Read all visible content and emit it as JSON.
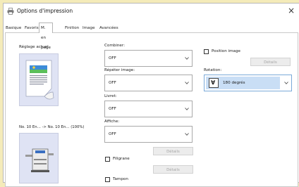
{
  "window": {
    "title": "Options d'impression",
    "close_label": "×"
  },
  "tabs": [
    {
      "label": "Basique",
      "active": false
    },
    {
      "label": "Favoris",
      "active": false
    },
    {
      "label": "M. en page",
      "active": true
    },
    {
      "label": "Finition",
      "active": false
    },
    {
      "label": "Image",
      "active": false
    },
    {
      "label": "Avancées",
      "active": false
    }
  ],
  "left": {
    "current_setting_label": "Réglage actuel",
    "paper_info": "No. 10 En… -> No. 10 En… (100%)"
  },
  "middle": {
    "combine": {
      "label": "Combiner:",
      "value": "OFF"
    },
    "repeat": {
      "label": "Répéter image:",
      "value": "OFF"
    },
    "booklet": {
      "label": "Livret:",
      "value": "OFF"
    },
    "poster": {
      "label": "Affiche:",
      "value": "OFF"
    },
    "details_label": "Détails",
    "watermark_label": "Filigrane",
    "stamp_label": "Tampon"
  },
  "right": {
    "image_position_label": "Position image",
    "details_label": "Détails",
    "rotation": {
      "label": "Rotation:",
      "value": "180 degrés"
    }
  },
  "colors": {
    "background": "#f4ebb9",
    "preview_bg": "#dfe3f4",
    "selection": "#c9def5",
    "focus_border": "#7aa9d9"
  }
}
